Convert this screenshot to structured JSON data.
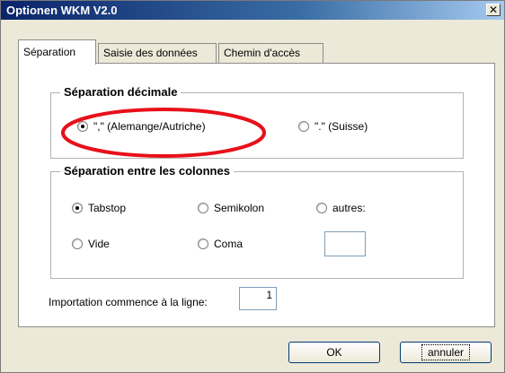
{
  "window": {
    "title": "Optionen WKM V2.0",
    "close_symbol": "✕"
  },
  "tabs": [
    {
      "label": "Séparation",
      "active": true
    },
    {
      "label": "Saisie des données",
      "active": false
    },
    {
      "label": "Chemin d'accès",
      "active": false
    }
  ],
  "decimal_group": {
    "title": "Séparation décimale",
    "options": [
      {
        "label": "\",\" (Alemange/Autriche)",
        "checked": true
      },
      {
        "label": "\".\" (Suisse)",
        "checked": false
      }
    ]
  },
  "column_group": {
    "title": "Séparation entre les colonnes",
    "options": [
      {
        "label": "Tabstop",
        "checked": true
      },
      {
        "label": "Semikolon",
        "checked": false
      },
      {
        "label": "autres:",
        "checked": false
      },
      {
        "label": "Vide",
        "checked": false
      },
      {
        "label": "Coma",
        "checked": false
      }
    ],
    "other_value": ""
  },
  "import_start": {
    "label": "Importation commence à la ligne:",
    "value": "1"
  },
  "buttons": {
    "ok": "OK",
    "cancel": "annuler"
  },
  "annotation": {
    "color": "#e8101a"
  }
}
